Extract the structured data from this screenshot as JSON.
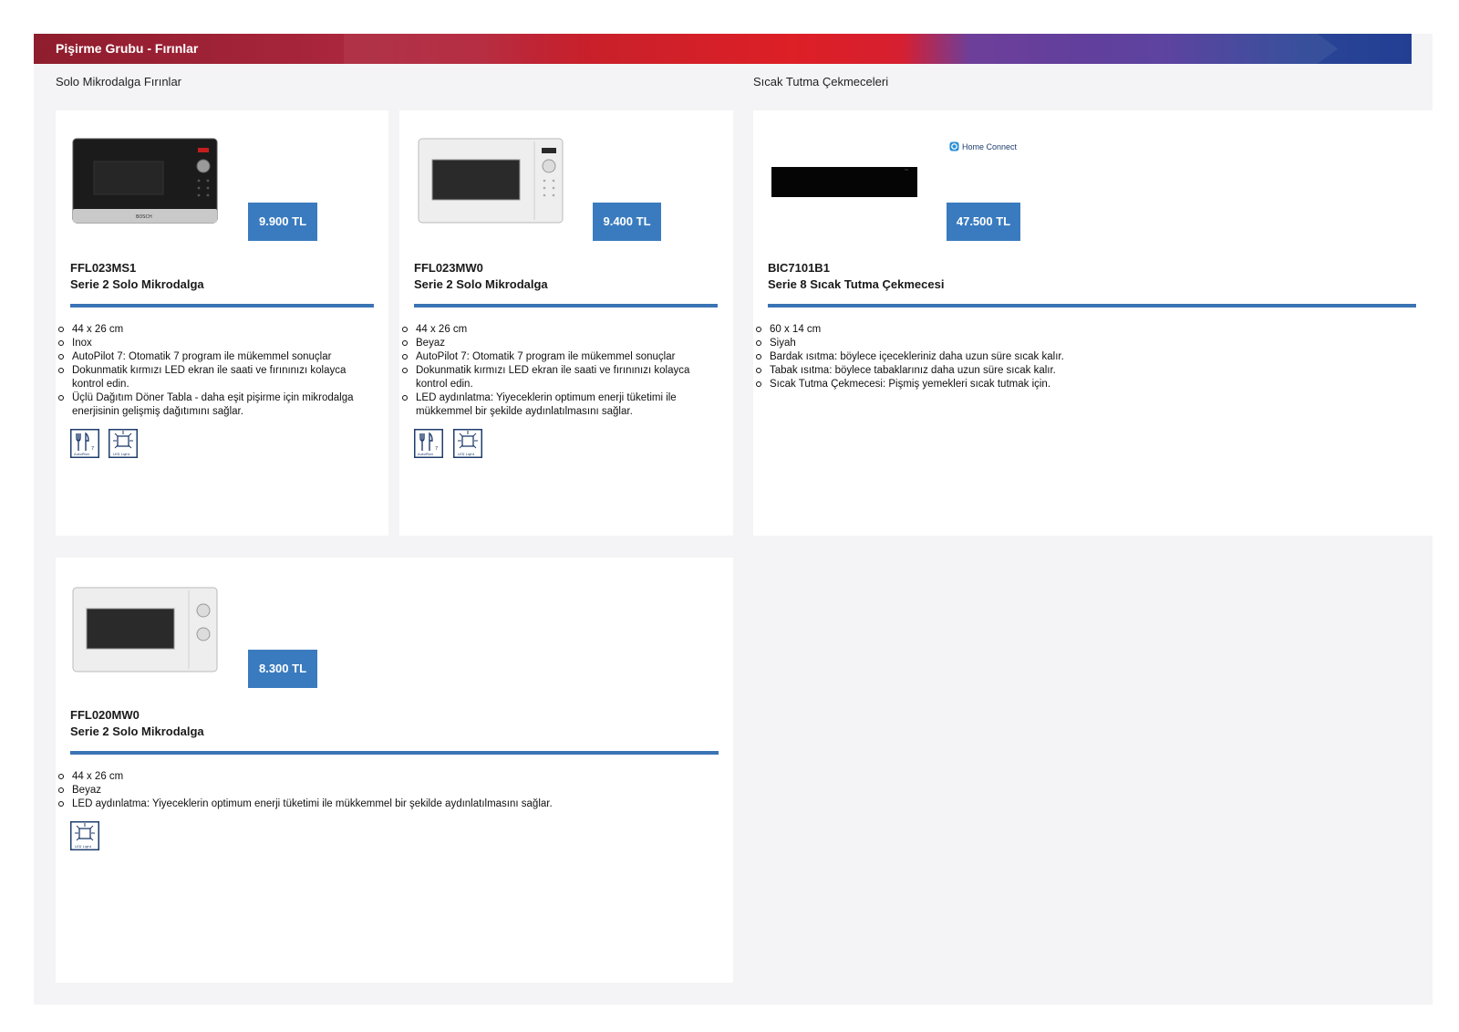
{
  "header": {
    "title": "Pişirme Grubu - Fırınlar"
  },
  "sections": {
    "solo": "Solo Mikrodalga Fırınlar",
    "warming": "Sıcak Tutma Çekmeceleri"
  },
  "products": [
    {
      "price": "9.900 TL",
      "code": "FFL023MS1",
      "name": "Serie 2 Solo Mikrodalga",
      "features": [
        "44 x 26 cm",
        "Inox",
        "AutoPilot 7: Otomatik 7 program ile mükemmel sonuçlar",
        "Dokunmatik kırmızı LED ekran ile saati ve fırınınızı kolayca kontrol edin.",
        "Üçlü Dağıtım Döner Tabla - daha eşit pişirme için mikrodalga enerjisinin gelişmiş dağıtımını sağlar."
      ],
      "badges": {
        "autopilot_num": "7",
        "autopilot": "AutoPilot",
        "led": "LED Light"
      }
    },
    {
      "price": "9.400 TL",
      "code": "FFL023MW0",
      "name": "Serie 2 Solo Mikrodalga",
      "features": [
        "44 x 26 cm",
        "Beyaz",
        "AutoPilot 7: Otomatik 7 program ile mükemmel sonuçlar",
        "Dokunmatik kırmızı LED ekran ile saati ve fırınınızı kolayca kontrol edin.",
        "LED aydınlatma: Yiyeceklerin optimum enerji tüketimi ile mükkemmel bir şekilde aydınlatılmasını sağlar."
      ],
      "badges": {
        "autopilot_num": "7",
        "autopilot": "AutoPilot",
        "led": "LED Light"
      }
    },
    {
      "price": "47.500 TL",
      "code": "BIC7101B1",
      "name": "Serie 8 Sıcak Tutma Çekmecesi",
      "home_connect": "Home Connect",
      "features": [
        "60 x 14 cm",
        "Siyah",
        "Bardak ısıtma: böylece içecekleriniz daha uzun süre sıcak kalır.",
        "Tabak ısıtma: böylece tabaklarınız daha uzun süre sıcak kalır.",
        "Sıcak Tutma Çekmecesi: Pişmiş yemekleri sıcak tutmak için."
      ]
    },
    {
      "price": "8.300 TL",
      "code": "FFL020MW0",
      "name": "Serie 2 Solo Mikrodalga",
      "features": [
        "44 x 26 cm",
        "Beyaz",
        "LED aydınlatma: Yiyeceklerin optimum enerji tüketimi ile mükkemmel bir şekilde aydınlatılmasını sağlar."
      ],
      "badges": {
        "led": "LED Light"
      }
    }
  ]
}
